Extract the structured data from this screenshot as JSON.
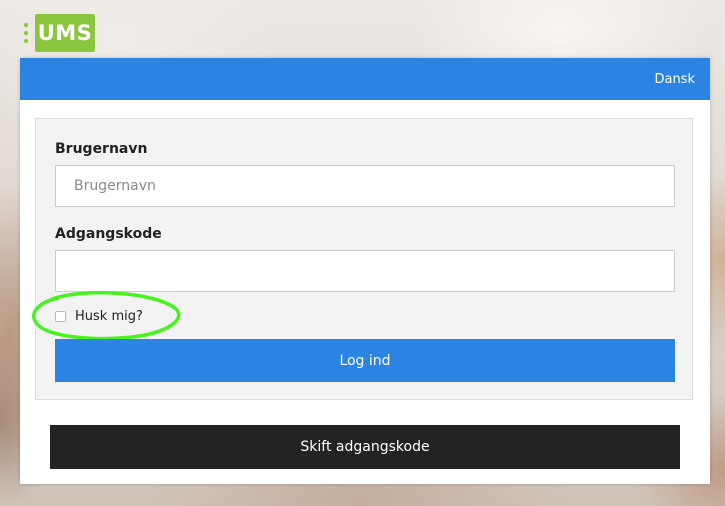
{
  "logo": {
    "text": "UMS"
  },
  "header": {
    "language_label": "Dansk"
  },
  "form": {
    "username_label": "Brugernavn",
    "username_placeholder": "Brugernavn",
    "username_value": "",
    "password_label": "Adgangskode",
    "password_value": "",
    "remember_label": "Husk mig?",
    "remember_checked": false,
    "login_label": "Log ind"
  },
  "footer": {
    "change_password_label": "Skift adgangskode"
  },
  "colors": {
    "brand_green": "#8cc63f",
    "primary_blue": "#2b84e2",
    "dark_button": "#232323",
    "annotation_green": "#49f21f"
  }
}
